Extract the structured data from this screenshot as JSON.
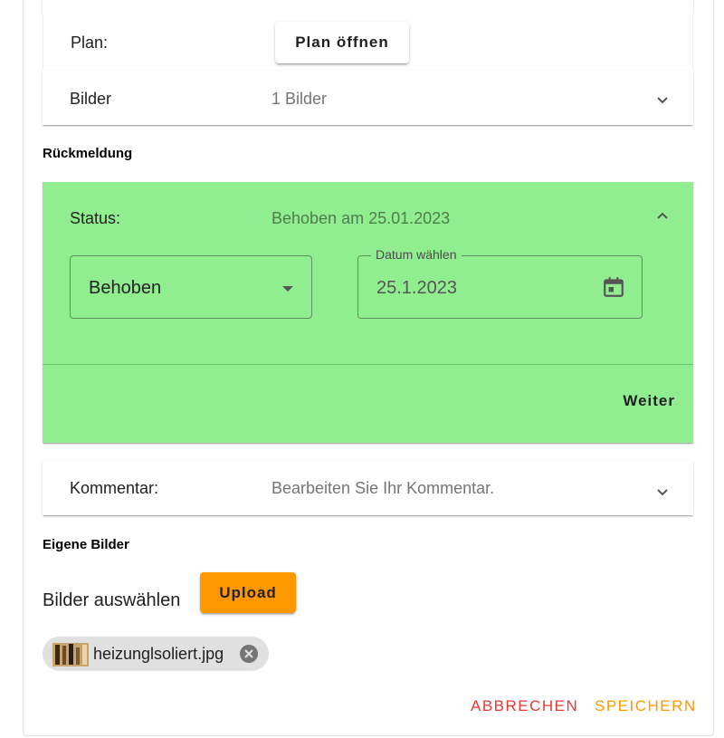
{
  "plan_row": {
    "label": "Plan:",
    "button": "Plan öffnen"
  },
  "bilder_row": {
    "label": "Bilder",
    "value": "1 Bilder",
    "icon": "chevron-down-icon"
  },
  "rueckmeldung": {
    "title": "Rückmeldung",
    "background_color": "#90ee90",
    "status_label": "Status:",
    "status_value": "Behoben am 25.01.2023",
    "expand_icon": "chevron-up-icon",
    "select_value": "Behoben",
    "date_legend": "Datum wählen",
    "date_value": "25.1.2023",
    "date_icon": "calendar-icon",
    "next_button": "Weiter"
  },
  "kommentar_row": {
    "label": "Kommentar:",
    "placeholder": "Bearbeiten Sie Ihr Kommentar.",
    "icon": "chevron-down-icon"
  },
  "eigene_bilder": {
    "title": "Eigene Bilder",
    "select_label": "Bilder auswählen",
    "upload_button": "Upload",
    "upload_color": "#ff9800",
    "file_chip": {
      "name": "heizunglsoliert.jpg",
      "remove_icon": "close-circle-icon"
    }
  },
  "actions": {
    "cancel": "ABBRECHEN",
    "cancel_color": "#e53935",
    "save": "SPEICHERN",
    "save_color": "#ff9800"
  }
}
